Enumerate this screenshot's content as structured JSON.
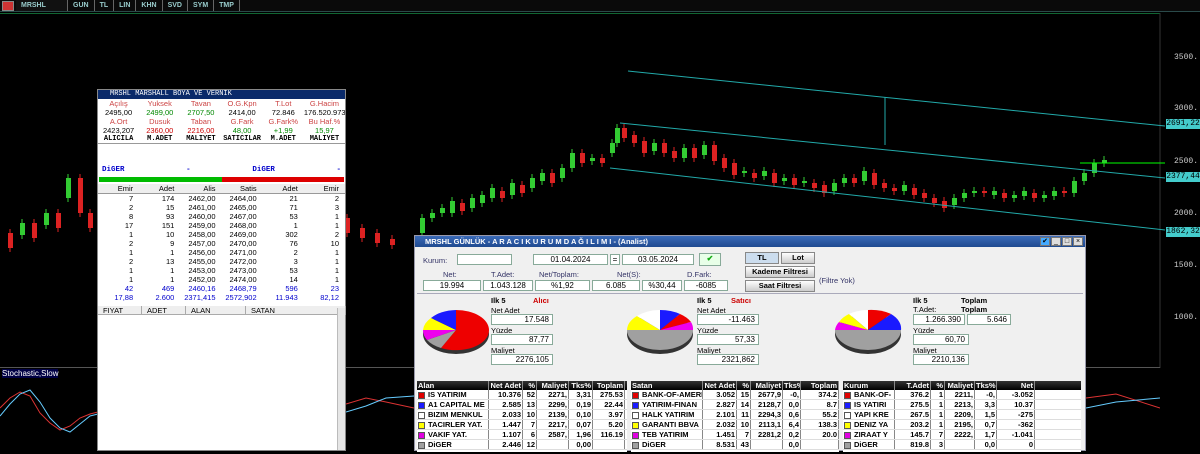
{
  "toolbar": {
    "symbol": "MRSHL",
    "items": [
      "GUN",
      "TL",
      "LIN",
      "KHN",
      "SVD",
      "SYM",
      "TMP"
    ]
  },
  "axis": {
    "ticks": [
      "3500.",
      "3000.",
      "2500.",
      "2000.",
      "1500.",
      "1000."
    ],
    "labels": [
      "2691,22",
      "2377,44",
      "1862,32"
    ]
  },
  "stoch": {
    "label": "Stochastic,Slow"
  },
  "left": {
    "title": "MRSHL    MARSHALL BOYA VE VERNIK",
    "hdr1": [
      "Açılış",
      "Yuksek",
      "Tavan",
      "O.G.Kpn",
      "T.Lot",
      "G.Hacim"
    ],
    "val1": [
      "2495,00",
      "2499,00",
      "2707,50",
      "2414,00",
      "72.846",
      "176.520.973"
    ],
    "hdr2": [
      "A.Ort",
      "Dusuk",
      "Taban",
      "G.Fark",
      "G.Fark%",
      "Bu Haf.%"
    ],
    "val2": [
      "2423,207",
      "2360,00",
      "2216,00",
      "48,00",
      "+1,99",
      "15,97"
    ],
    "hdr3": [
      "ALICILA",
      "M.ADET",
      "MALIYET",
      "SATICILAR",
      "M.ADET",
      "MALIYET"
    ],
    "digerL": "DiGER",
    "dash": "-",
    "digerR": "DiGER",
    "dash2": "-",
    "cols": [
      "Emir",
      "Adet",
      "Alis",
      "Satis",
      "Adet",
      "Emir"
    ],
    "rows": [
      [
        "7",
        "174",
        "2462,00",
        "2464,00",
        "21",
        "2"
      ],
      [
        "2",
        "15",
        "2461,00",
        "2465,00",
        "71",
        "3"
      ],
      [
        "8",
        "93",
        "2460,00",
        "2467,00",
        "53",
        "1"
      ],
      [
        "17",
        "151",
        "2459,00",
        "2468,00",
        "1",
        "1"
      ],
      [
        "1",
        "10",
        "2458,00",
        "2469,00",
        "302",
        "2"
      ],
      [
        "2",
        "9",
        "2457,00",
        "2470,00",
        "76",
        "10"
      ],
      [
        "1",
        "1",
        "2456,00",
        "2471,00",
        "2",
        "1"
      ],
      [
        "2",
        "13",
        "2455,00",
        "2472,00",
        "3",
        "1"
      ],
      [
        "1",
        "1",
        "2453,00",
        "2473,00",
        "53",
        "1"
      ],
      [
        "1",
        "1",
        "2452,00",
        "2474,00",
        "14",
        "1"
      ]
    ],
    "tot1": [
      "42",
      "469",
      "2460,16",
      "2468,79",
      "596",
      "23"
    ],
    "tot2": [
      "17,88",
      "2.600",
      "2371,415",
      "2572,902",
      "11.943",
      "82,12"
    ],
    "bottom": [
      "FIYAT",
      "ADET",
      "ALAN",
      "SATAN"
    ]
  },
  "right": {
    "title": "MRSHL GÜNLÜK - A R A C I   K U R U M   D A Ğ I L I M I - (Analist)",
    "kurum_label": "Kurum:",
    "date1": "01.04.2024",
    "eq": "=",
    "date2": "03.05.2024",
    "tl": "TL",
    "lot": "Lot",
    "kademe": "Kademe Filtresi",
    "saat": "Saat Filtresi",
    "filtre": "(Filtre Yok)",
    "net_l": "Net:",
    "tadet_l": "T.Adet:",
    "nettop_l": "Net/Toplam:",
    "nets_l": "Net(S):",
    "dfark_l": "D.Fark:",
    "net": "19.994",
    "tadet": "1.043.128",
    "nettop": "%1,92",
    "nets": "6.085",
    "pct": "%30,44",
    "dfark": "-6085",
    "p1": {
      "a": "Ilk 5",
      "b": "Alıcı",
      "na": "Net Adet",
      "nv": "17.548",
      "ya": "Yüzde",
      "yv": "87,77",
      "ma": "Maliyet",
      "mv": "2276,105"
    },
    "p2": {
      "a": "Ilk 5",
      "b": "Satıcı",
      "na": "Net Adet",
      "nv": "-11.463",
      "ya": "Yüzde",
      "yv": "57,33",
      "ma": "Maliyet",
      "mv": "2321,862"
    },
    "p3": {
      "a": "Ilk 5",
      "b": "Toplam",
      "c": "Toplam",
      "na": "T.Adet:",
      "nv": "1.266.390",
      "nv2": "5.646",
      "ya": "Yüzde",
      "yv": "60,70",
      "ma": "Maliyet",
      "mv": "2210,136"
    },
    "g1h": [
      "Alan",
      "Net Adet",
      "%",
      "Maliyet",
      "Tks%",
      "Toplam"
    ],
    "g1": [
      [
        "IS YATIRIM",
        "10.376",
        "52",
        "2271,",
        "3,31",
        "275.53"
      ],
      [
        "A1 CAPITAL ME",
        "2.585",
        "13",
        "2299,",
        "0,19",
        "22.44"
      ],
      [
        "BIZIM MENKUL",
        "2.033",
        "10",
        "2139,",
        "0,10",
        "3.97"
      ],
      [
        "TACIRLER YAT.",
        "1.447",
        "7",
        "2217,",
        "0,07",
        "5.20"
      ],
      [
        "VAKIF YAT.",
        "1.107",
        "6",
        "2587,",
        "1,96",
        "116.19"
      ],
      [
        "DiGER",
        "2.446",
        "12",
        "",
        "0,00",
        ""
      ]
    ],
    "g2h": [
      "Satan",
      "Net Adet",
      "%",
      "Maliyet",
      "Tks%",
      "Toplam"
    ],
    "g2": [
      [
        "BANK-OF-AMERI",
        "3.052",
        "15",
        "2677,9",
        "-0,",
        "374.2"
      ],
      [
        "YATIRIM-FINAN",
        "2.827",
        "14",
        "2128,7",
        "0,0",
        "8.7"
      ],
      [
        "HALK YATIRIM",
        "2.101",
        "11",
        "2294,3",
        "0,6",
        "55.2"
      ],
      [
        "GARANTI BBVA",
        "2.032",
        "10",
        "2113,1",
        "6,4",
        "138.3"
      ],
      [
        "TEB YATIRIM",
        "1.451",
        "7",
        "2281,2",
        "0,2",
        "20.0"
      ],
      [
        "DiGER",
        "8.531",
        "43",
        "",
        "0,0",
        ""
      ]
    ],
    "g3h": [
      "Kurum",
      "T.Adet",
      "%",
      "Maliyet",
      "Tks%",
      "Net"
    ],
    "g3": [
      [
        "BANK-OF-",
        "376.2",
        "1",
        "2211,",
        "-0,",
        "-3.052"
      ],
      [
        "IS YATIRI",
        "275.5",
        "1",
        "2213,",
        "3,3",
        "10.37"
      ],
      [
        "YAPI KRE",
        "267.5",
        "1",
        "2209,",
        "1,5",
        "-275"
      ],
      [
        "DENIZ YA",
        "203.2",
        "1",
        "2195,",
        "0,7",
        "-362"
      ],
      [
        "ZIRAAT Y",
        "145.7",
        "7",
        "2222,",
        "1,7",
        "-1.041"
      ],
      [
        "DiGER",
        "819.8",
        "3",
        "",
        "0,0",
        "0"
      ]
    ],
    "colors": [
      "#e00000",
      "#1a1aff",
      "#ffffff",
      "#ffff00",
      "#e000e0",
      "#a0a0a0"
    ]
  }
}
